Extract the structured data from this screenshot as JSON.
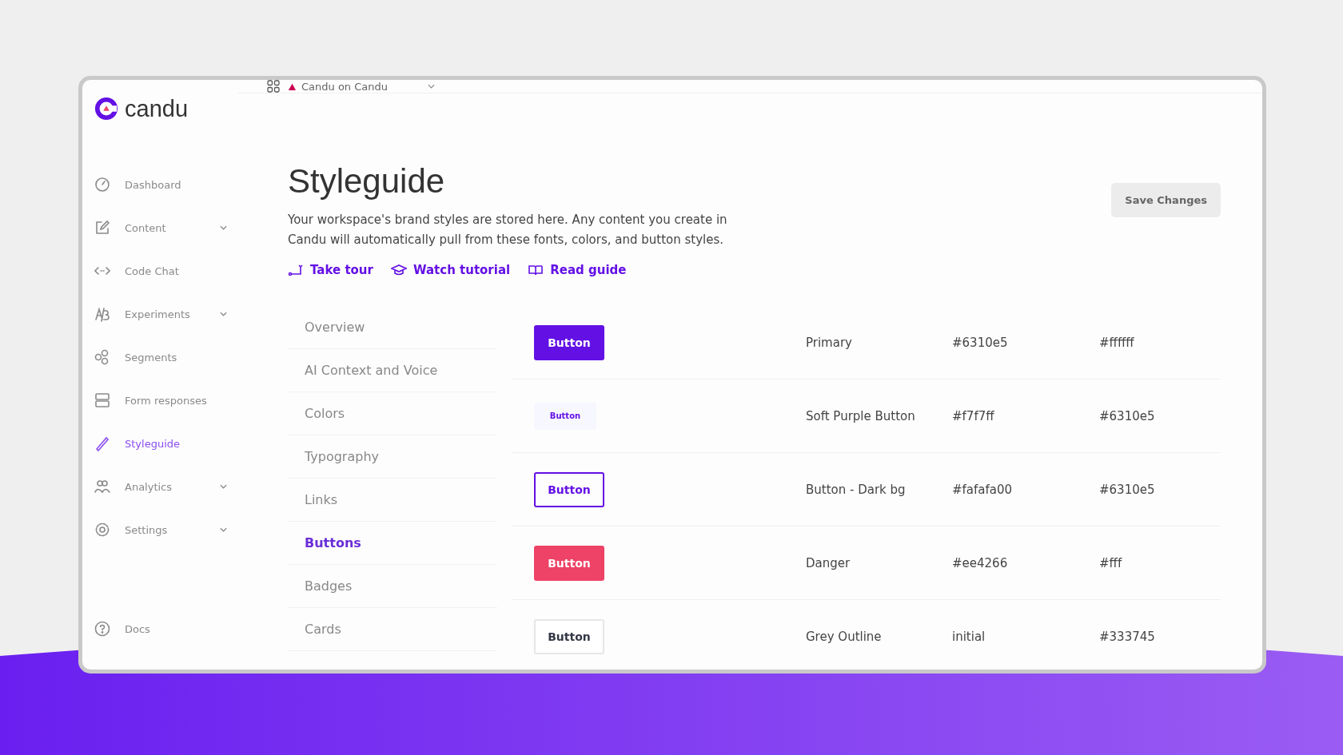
{
  "app": {
    "logo": "candu",
    "workspace": "Candu on Candu"
  },
  "sidebar": {
    "items": [
      {
        "label": "Dashboard",
        "kind": "gauge",
        "expandable": false,
        "selected": false
      },
      {
        "label": "Content",
        "kind": "edit",
        "expandable": true,
        "selected": false
      },
      {
        "label": "Code Chat",
        "kind": "code",
        "expandable": false,
        "selected": false
      },
      {
        "label": "Experiments",
        "kind": "ab",
        "expandable": true,
        "selected": false
      },
      {
        "label": "Segments",
        "kind": "segments",
        "expandable": false,
        "selected": false
      },
      {
        "label": "Form responses",
        "kind": "form",
        "expandable": false,
        "selected": false
      },
      {
        "label": "Styleguide",
        "kind": "brush",
        "expandable": false,
        "selected": true
      },
      {
        "label": "Analytics",
        "kind": "people",
        "expandable": true,
        "selected": false
      },
      {
        "label": "Settings",
        "kind": "gear",
        "expandable": true,
        "selected": false
      }
    ],
    "footer": [
      {
        "label": "Docs",
        "kind": "help"
      }
    ]
  },
  "page": {
    "title": "Styleguide",
    "description": "Your workspace's brand styles are stored here. Any content you create in Candu will automatically pull from these fonts, colors, and button styles.",
    "save_button": "Save Changes",
    "links": [
      {
        "label": "Take tour",
        "kind": "tour"
      },
      {
        "label": "Watch tutorial",
        "kind": "cap"
      },
      {
        "label": "Read guide",
        "kind": "book"
      }
    ]
  },
  "sections": [
    {
      "label": "Overview",
      "selected": false
    },
    {
      "label": "AI Context and Voice",
      "selected": false
    },
    {
      "label": "Colors",
      "selected": false
    },
    {
      "label": "Typography",
      "selected": false
    },
    {
      "label": "Links",
      "selected": false
    },
    {
      "label": "Buttons",
      "selected": true
    },
    {
      "label": "Badges",
      "selected": false
    },
    {
      "label": "Cards",
      "selected": false
    }
  ],
  "buttons_table": {
    "rows": [
      {
        "kind": "solid",
        "preview": "Button",
        "name": "Primary",
        "background": "#6310e5",
        "text_color": "#ffffff"
      },
      {
        "kind": "soft",
        "preview": "Button",
        "name": "Soft Purple Button",
        "background": "#f7f7ff",
        "text_color": "#6310e5"
      },
      {
        "kind": "outline",
        "preview": "Button",
        "name": "Button - Dark bg",
        "background": "#fafafa00",
        "text_color": "#6310e5"
      },
      {
        "kind": "solid",
        "preview": "Button",
        "name": "Danger",
        "background": "#ee4266",
        "text_color": "#fff"
      },
      {
        "kind": "outline",
        "preview": "Button",
        "name": "Grey Outline",
        "background": "initial",
        "text_color": "#333745"
      }
    ]
  }
}
